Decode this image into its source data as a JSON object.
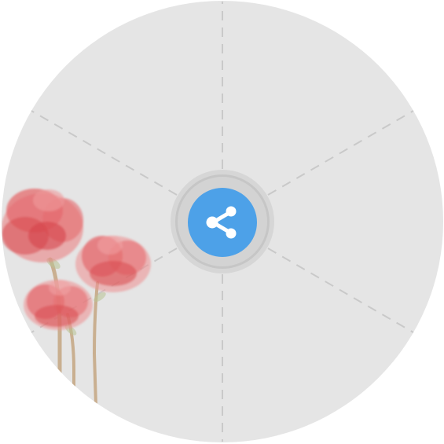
{
  "radial_menu": {
    "sector_count": 6,
    "colors": {
      "background": "#e5e5e5",
      "divider": "#c9c9c9",
      "hub_outer": "#d6d6d6",
      "hub_ring": "#c6c6c6",
      "button": "#4da1e8",
      "icon": "#ffffff",
      "petal": "#e05a5e",
      "stem": "#c6a987"
    }
  },
  "center_button": {
    "icon": "share-icon",
    "action": "share"
  }
}
